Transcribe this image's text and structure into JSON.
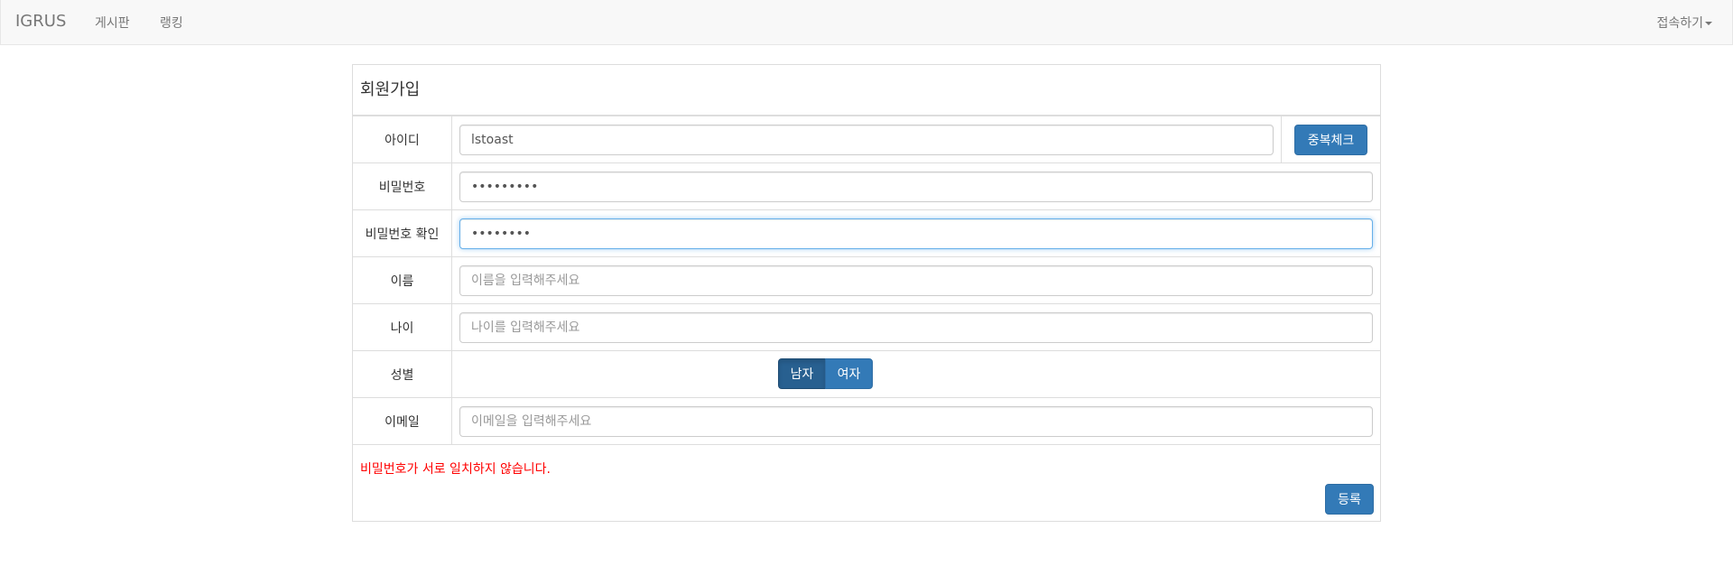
{
  "navbar": {
    "brand": "IGRUS",
    "links": [
      "게시판",
      "랭킹"
    ],
    "right_label": "접속하기"
  },
  "form": {
    "title": "회원가입",
    "id": {
      "label": "아이디",
      "value": "lstoast",
      "check_button": "중복체크"
    },
    "password": {
      "label": "비밀번호",
      "value": "•••••••••"
    },
    "password_confirm": {
      "label": "비밀번호 확인",
      "value": "••••••••"
    },
    "name": {
      "label": "이름",
      "placeholder": "이름을 입력해주세요"
    },
    "age": {
      "label": "나이",
      "placeholder": "나이를 입력해주세요"
    },
    "gender": {
      "label": "성별",
      "options": [
        "남자",
        "여자"
      ],
      "selected": "남자"
    },
    "email": {
      "label": "이메일",
      "placeholder": "이메일을 입력해주세요"
    },
    "error_message": "비밀번호가 서로 일치하지 않습니다.",
    "submit_button": "등록"
  },
  "colors": {
    "primary": "#337ab7",
    "active": "#286090",
    "error": "#ff0000",
    "navbar_bg": "#f8f8f8"
  }
}
